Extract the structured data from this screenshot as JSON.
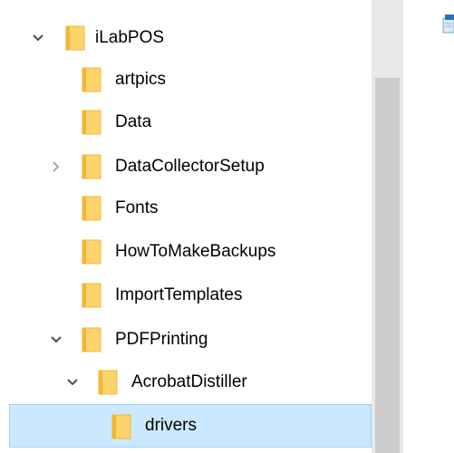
{
  "tree": {
    "items": [
      {
        "label": "iLabPOS",
        "expander": "expanded"
      },
      {
        "label": "artpics",
        "expander": "none"
      },
      {
        "label": "Data",
        "expander": "none"
      },
      {
        "label": "DataCollectorSetup",
        "expander": "collapsed"
      },
      {
        "label": "Fonts",
        "expander": "none"
      },
      {
        "label": "HowToMakeBackups",
        "expander": "none"
      },
      {
        "label": "ImportTemplates",
        "expander": "none"
      },
      {
        "label": "PDFPrinting",
        "expander": "expanded"
      },
      {
        "label": "AcrobatDistiller",
        "expander": "expanded"
      },
      {
        "label": "drivers",
        "expander": "none",
        "selected": true
      }
    ]
  },
  "colors": {
    "folder_fill": "#fcd46c",
    "folder_edge": "#f3b635",
    "selection_fill": "#cce8ff",
    "selection_border": "#99d1ff",
    "expanded_chevron": "#4d4d4d",
    "collapsed_chevron": "#a6a6a6",
    "scrollbar_track": "#e9e9e9",
    "scrollbar_thumb": "#cdcdcd"
  },
  "icons": {
    "expanded": "chevron-down-icon",
    "collapsed": "chevron-right-icon",
    "folder": "folder-icon",
    "corner": "file-icon"
  }
}
